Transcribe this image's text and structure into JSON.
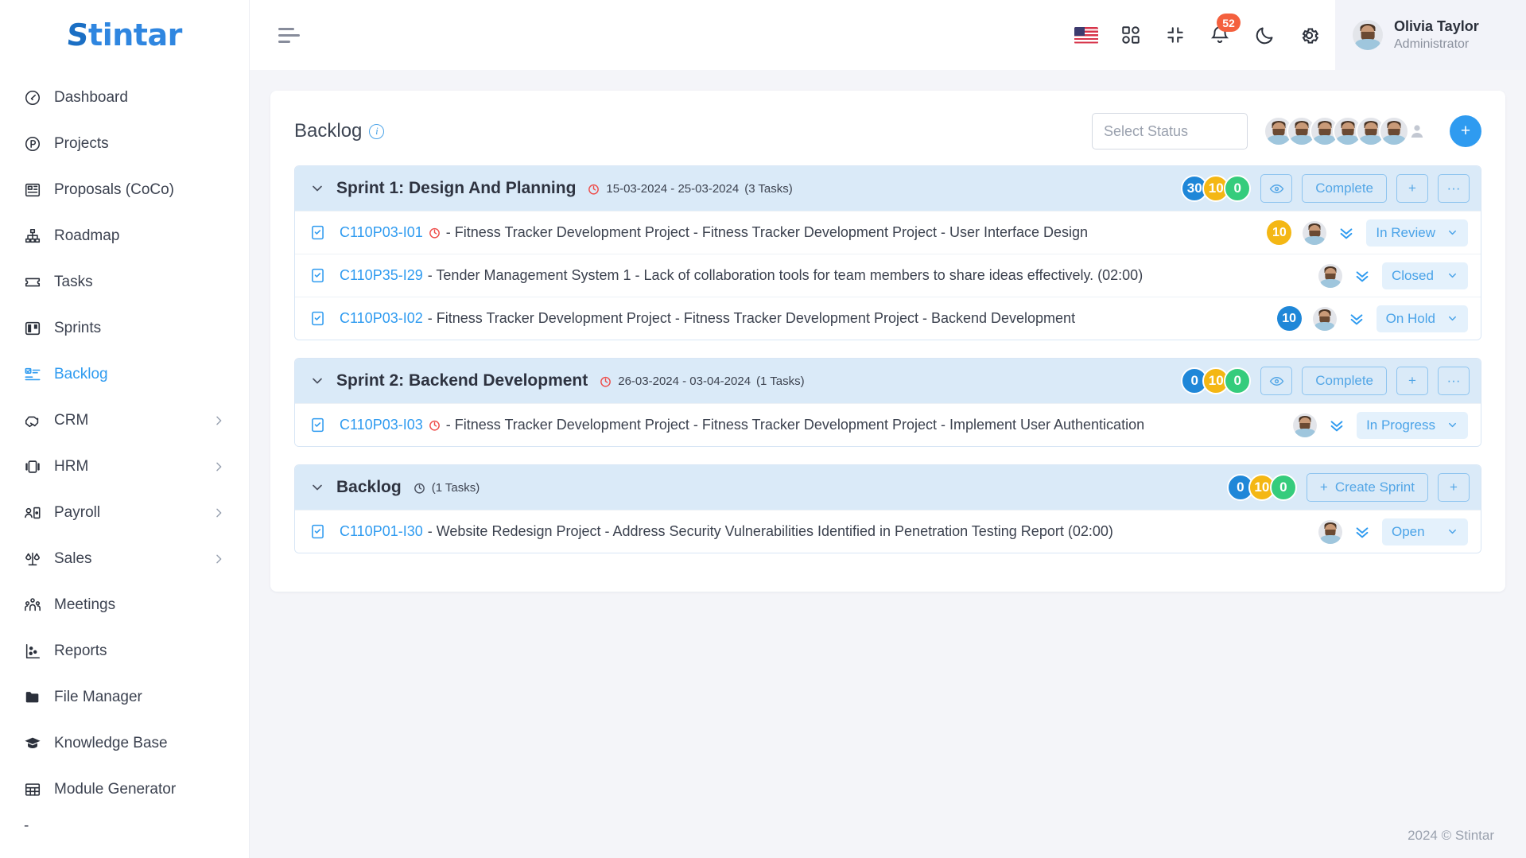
{
  "brand": {
    "name": "Stintar",
    "mark": "S",
    "rest": "tintar"
  },
  "sidebar": {
    "items": [
      {
        "label": "Dashboard",
        "icon": "gauge-icon",
        "active": false,
        "expandable": false
      },
      {
        "label": "Projects",
        "icon": "circle-p-icon",
        "active": false,
        "expandable": false
      },
      {
        "label": "Proposals (CoCo)",
        "icon": "layout-icon",
        "active": false,
        "expandable": false
      },
      {
        "label": "Roadmap",
        "icon": "sitemap-icon",
        "active": false,
        "expandable": false
      },
      {
        "label": "Tasks",
        "icon": "ticket-icon",
        "active": false,
        "expandable": false
      },
      {
        "label": "Sprints",
        "icon": "board-icon",
        "active": false,
        "expandable": false
      },
      {
        "label": "Backlog",
        "icon": "checklist-icon",
        "active": true,
        "expandable": false
      },
      {
        "label": "CRM",
        "icon": "handshake-icon",
        "active": false,
        "expandable": true
      },
      {
        "label": "HRM",
        "icon": "carousel-icon",
        "active": false,
        "expandable": true
      },
      {
        "label": "Payroll",
        "icon": "user-card-icon",
        "active": false,
        "expandable": true
      },
      {
        "label": "Sales",
        "icon": "scale-icon",
        "active": false,
        "expandable": true
      },
      {
        "label": "Meetings",
        "icon": "people-icon",
        "active": false,
        "expandable": false
      },
      {
        "label": "Reports",
        "icon": "scatter-icon",
        "active": false,
        "expandable": false
      },
      {
        "label": "File Manager",
        "icon": "folder-icon",
        "active": false,
        "expandable": false
      },
      {
        "label": "Knowledge Base",
        "icon": "graduation-cap-icon",
        "active": false,
        "expandable": false
      },
      {
        "label": "Module Generator",
        "icon": "grid-table-icon",
        "active": false,
        "expandable": false
      }
    ],
    "trailing": "-"
  },
  "topbar": {
    "menu_icon": "hamburger-icon",
    "language_flag": "us-flag-icon",
    "apps_icon": "apps-grid-icon",
    "collapse_icon": "compress-icon",
    "notifications_icon": "bell-icon",
    "notifications_count": "52",
    "theme_icon": "moon-icon",
    "settings_icon": "gear-icon",
    "user": {
      "name": "Olivia Taylor",
      "role": "Administrator",
      "avatar": "user-avatar"
    }
  },
  "page": {
    "title": "Backlog",
    "info_icon": "info-icon",
    "status_filter": {
      "placeholder": "Select Status",
      "value": ""
    },
    "member_avatars": 6,
    "add_member_label": "+"
  },
  "colors": {
    "accent": "#2f9bf0",
    "pill_blue": "#1f87d8",
    "pill_amber": "#f4b714",
    "pill_green": "#35cc7c",
    "badge_red": "#f4603e",
    "group_header_bg": "#daeaf8"
  },
  "groups": [
    {
      "name": "Sprint 1: Design And Planning",
      "dates": "15-03-2024 - 25-03-2024",
      "task_count_label": "(3 Tasks)",
      "clock_color": "red",
      "pills": [
        "30",
        "10",
        "0"
      ],
      "buttons": {
        "view": "eye-icon",
        "complete": "Complete",
        "add": "+",
        "more": "···"
      },
      "kind": "sprint",
      "tasks": [
        {
          "code": "C110P03-I01",
          "has_clock": true,
          "text": "- Fitness Tracker Development Project - Fitness Tracker Development Project - User Interface Design",
          "estimate": "10",
          "estimate_color": "amber",
          "status": "In Review"
        },
        {
          "code": "C110P35-I29",
          "has_clock": false,
          "text": "- Tender Management System 1 - Lack of collaboration tools for team members to share ideas effectively. (02:00)",
          "estimate": "",
          "estimate_color": "",
          "status": "Closed"
        },
        {
          "code": "C110P03-I02",
          "has_clock": false,
          "text": "- Fitness Tracker Development Project - Fitness Tracker Development Project - Backend Development",
          "estimate": "10",
          "estimate_color": "blue",
          "status": "On Hold"
        }
      ]
    },
    {
      "name": "Sprint 2: Backend Development",
      "dates": "26-03-2024 - 03-04-2024",
      "task_count_label": "(1 Tasks)",
      "clock_color": "red",
      "pills": [
        "0",
        "10",
        "0"
      ],
      "buttons": {
        "view": "eye-icon",
        "complete": "Complete",
        "add": "+",
        "more": "···"
      },
      "kind": "sprint",
      "tasks": [
        {
          "code": "C110P03-I03",
          "has_clock": true,
          "text": "- Fitness Tracker Development Project - Fitness Tracker Development Project - Implement User Authentication",
          "estimate": "",
          "estimate_color": "",
          "status": "In Progress"
        }
      ]
    },
    {
      "name": "Backlog",
      "dates": "",
      "task_count_label": "(1 Tasks)",
      "clock_color": "gray",
      "pills": [
        "0",
        "10",
        "0"
      ],
      "buttons": {
        "create_sprint": "Create Sprint",
        "add": "+"
      },
      "kind": "backlog",
      "tasks": [
        {
          "code": "C110P01-I30",
          "has_clock": false,
          "text": "- Website Redesign Project - Address Security Vulnerabilities Identified in Penetration Testing Report (02:00)",
          "estimate": "",
          "estimate_color": "",
          "status": "Open"
        }
      ]
    }
  ],
  "footer": {
    "text": "2024 © Stintar"
  }
}
